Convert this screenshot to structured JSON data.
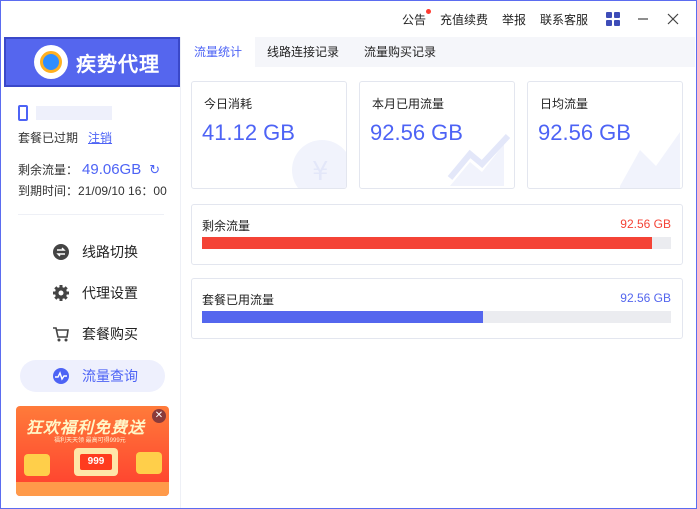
{
  "titlebar": {
    "links": [
      "公告",
      "充值续费",
      "举报",
      "联系客服"
    ],
    "has_notice_dot": true
  },
  "brand": {
    "name": "疾势代理"
  },
  "account": {
    "status": "套餐已过期",
    "logout_label": "注销",
    "remaining_label": "剩余流量：",
    "remaining_value": "49.06GB",
    "expire_label": "到期时间：",
    "expire_value": "21/09/10 16：00"
  },
  "nav": {
    "items": [
      {
        "label": "线路切换",
        "icon": "switch-icon"
      },
      {
        "label": "代理设置",
        "icon": "gear-icon"
      },
      {
        "label": "套餐购买",
        "icon": "cart-icon"
      },
      {
        "label": "流量查询",
        "icon": "pulse-icon",
        "active": true
      }
    ]
  },
  "promo": {
    "title": "狂欢福利免费送",
    "subtitle": "福利天天领 最高可得999元",
    "price": "999"
  },
  "tabs": [
    {
      "label": "流量统计",
      "active": true
    },
    {
      "label": "线路连接记录"
    },
    {
      "label": "流量购买记录"
    }
  ],
  "stats": [
    {
      "label": "今日消耗",
      "value": "41.12 GB",
      "icon": "yen-icon"
    },
    {
      "label": "本月已用流量",
      "value": "92.56 GB",
      "icon": "trend-icon"
    },
    {
      "label": "日均流量",
      "value": "92.56 GB",
      "icon": "chart-icon"
    }
  ],
  "usage": [
    {
      "label": "剩余流量",
      "value": "92.56 GB",
      "color": "#f44336",
      "fraction": 0.96
    },
    {
      "label": "套餐已用流量",
      "value": "92.56 GB",
      "color": "#5466ee",
      "fraction": 0.6
    }
  ],
  "colors": {
    "accent": "#4d63f5",
    "brand": "#5566ee",
    "danger": "#f44336"
  }
}
